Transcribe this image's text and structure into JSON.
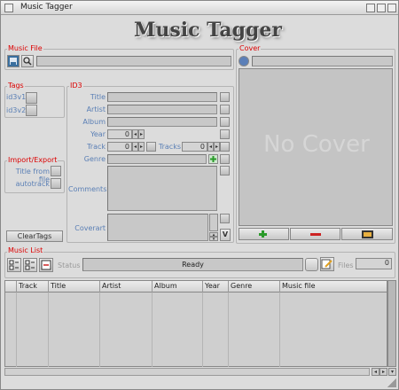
{
  "window": {
    "title": "Music Tagger"
  },
  "logo": "Music Tagger",
  "music_file": {
    "label": "Music File",
    "path": ""
  },
  "cover": {
    "label": "Cover",
    "path": "",
    "placeholder": "No Cover"
  },
  "tags": {
    "label": "Tags",
    "id3v1": "id3v1",
    "id3v2": "id3v2"
  },
  "id3": {
    "label": "ID3",
    "title_label": "Title",
    "title": "",
    "artist_label": "Artist",
    "artist": "",
    "album_label": "Album",
    "album": "",
    "year_label": "Year",
    "year": "0",
    "track_label": "Track",
    "track": "0",
    "tracks_label": "Tracks",
    "tracks": "0",
    "genre_label": "Genre",
    "genre": "",
    "comments_label": "Comments",
    "comments": "",
    "coverart_label": "Coverart"
  },
  "import_export": {
    "label": "Import/Export",
    "title_from_file": "Title from file",
    "autotrack": "autotrack"
  },
  "clear_tags": "ClearTags",
  "music_list": {
    "label": "Music List",
    "status_label": "Status",
    "status": "Ready",
    "files_label": "Files",
    "files": "0",
    "columns": [
      "",
      "Track",
      "Title",
      "Artist",
      "Album",
      "Year",
      "Genre",
      "Music file"
    ]
  }
}
